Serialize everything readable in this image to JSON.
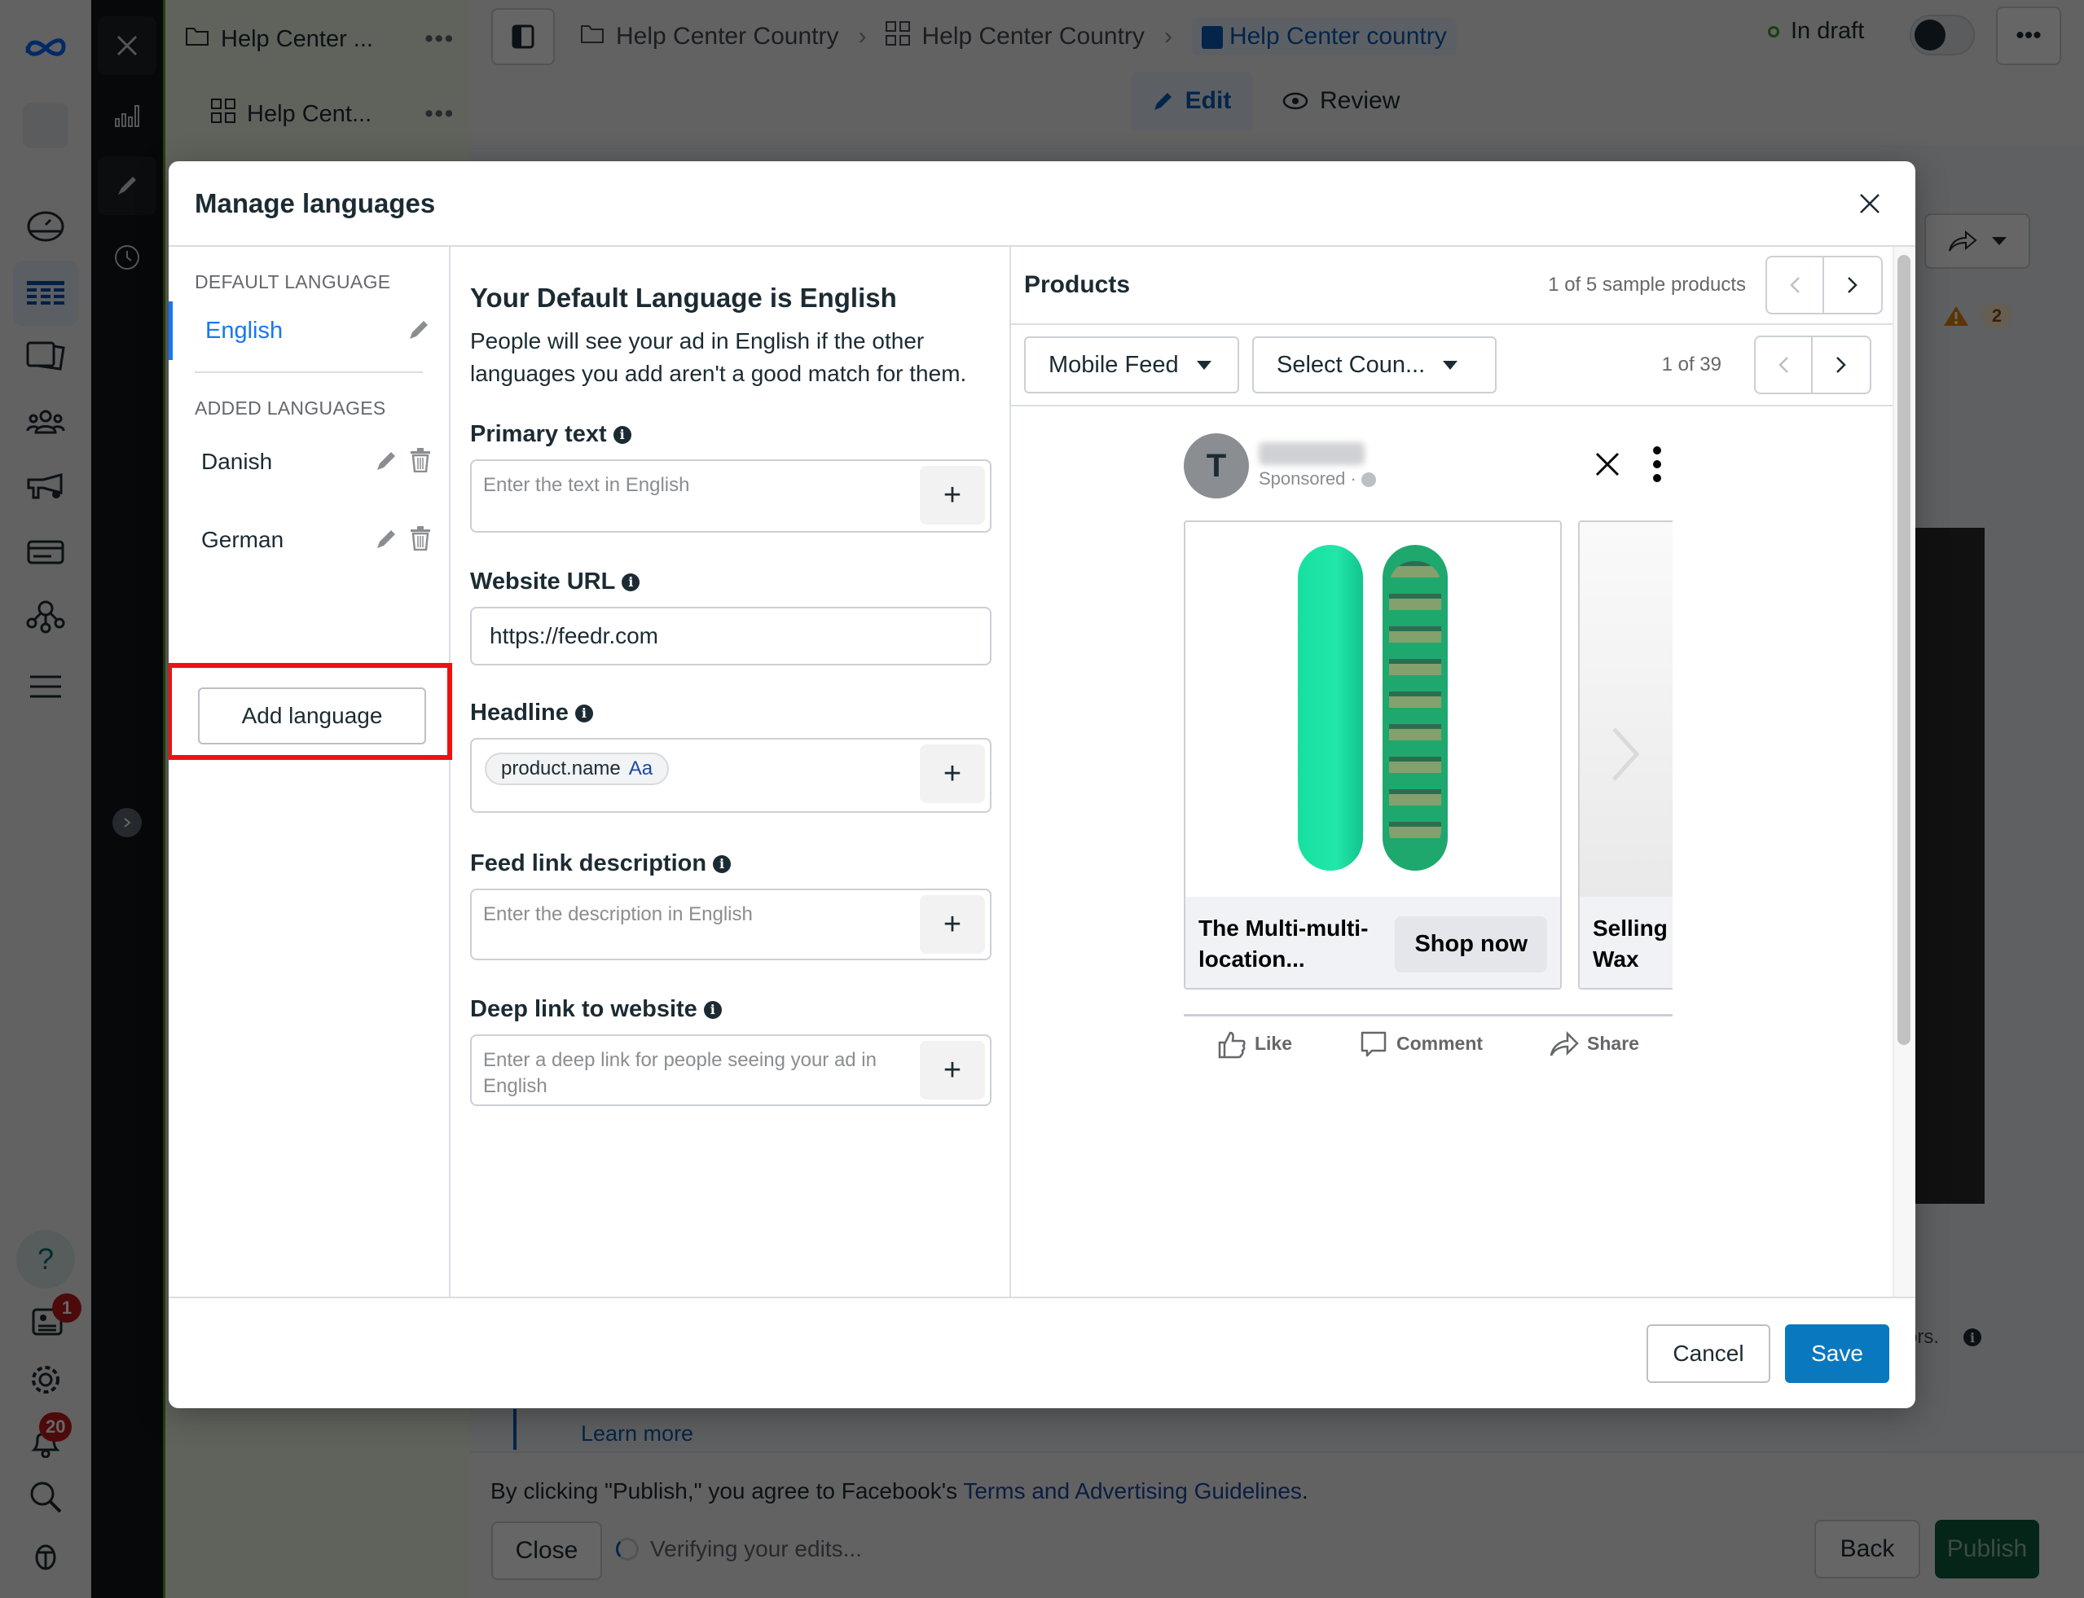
{
  "app": {
    "side_rail": {
      "items": [
        "meta-logo",
        "account-avatar",
        "dashboard-icon",
        "table-icon",
        "catalog-icon",
        "audiences-icon",
        "campaign-settings-icon",
        "billing-icon",
        "business-network-icon",
        "menu-icon"
      ],
      "bottom": {
        "help": "?",
        "news_badge": "1",
        "notifications_badge": "20"
      }
    },
    "tree": {
      "items": [
        {
          "label": "Help Center ...",
          "icon": "folder-icon"
        },
        {
          "label": "Help Cent...",
          "icon": "grid-icon"
        }
      ]
    },
    "breadcrumb": [
      {
        "label": "Help Center Country",
        "icon": "folder-icon"
      },
      {
        "label": "Help Center Country",
        "icon": "grid-icon"
      },
      {
        "label": "Help Center country",
        "icon": "ad-icon"
      }
    ],
    "status": "In draft",
    "mode_tabs": {
      "edit": "Edit",
      "review": "Review"
    },
    "warnings_count": "2",
    "errors_hint": "ors.",
    "learn_more": "Learn more",
    "footer": {
      "consent_prefix": "By clicking \"Publish,\" you agree to Facebook's ",
      "consent_link": "Terms and Advertising Guidelines",
      "consent_suffix": ".",
      "close": "Close",
      "verifying": "Verifying your edits...",
      "back": "Back",
      "publish": "Publish"
    }
  },
  "modal": {
    "title": "Manage languages",
    "default_language_label": "DEFAULT LANGUAGE",
    "default_language": "English",
    "added_languages_label": "ADDED LANGUAGES",
    "added_languages": [
      "Danish",
      "German"
    ],
    "add_language": "Add language",
    "form": {
      "heading": "Your Default Language is English",
      "description": "People will see your ad in English if the other languages you add aren't a good match for them.",
      "primary_text": {
        "label": "Primary text",
        "placeholder": "Enter the text in English"
      },
      "website_url": {
        "label": "Website URL",
        "value": "https://feedr.com"
      },
      "headline": {
        "label": "Headline",
        "chip": "product.name",
        "chip_suffix": "Aa"
      },
      "feed_link_description": {
        "label": "Feed link description",
        "placeholder": "Enter the description in English"
      },
      "deep_link": {
        "label": "Deep link to website",
        "placeholder": "Enter a deep link for people seeing your ad in English"
      }
    },
    "preview": {
      "title": "Products",
      "sample_count": "1 of 5 sample products",
      "placement": "Mobile Feed",
      "country": "Select Coun...",
      "placement_count": "1 of 39",
      "ad": {
        "avatar_letter": "T",
        "sponsored": "Sponsored · ",
        "cards": [
          {
            "title": "The Multi-multi-location...",
            "cta": "Shop now"
          },
          {
            "title": "Selling Wax"
          }
        ],
        "actions": [
          "Like",
          "Comment",
          "Share"
        ]
      }
    },
    "cancel": "Cancel",
    "save": "Save"
  },
  "colors": {
    "accent_blue": "#1877f2",
    "save_blue": "#0a78be",
    "highlight_red": "#ee1111",
    "publish_green": "#0b5c3a"
  }
}
